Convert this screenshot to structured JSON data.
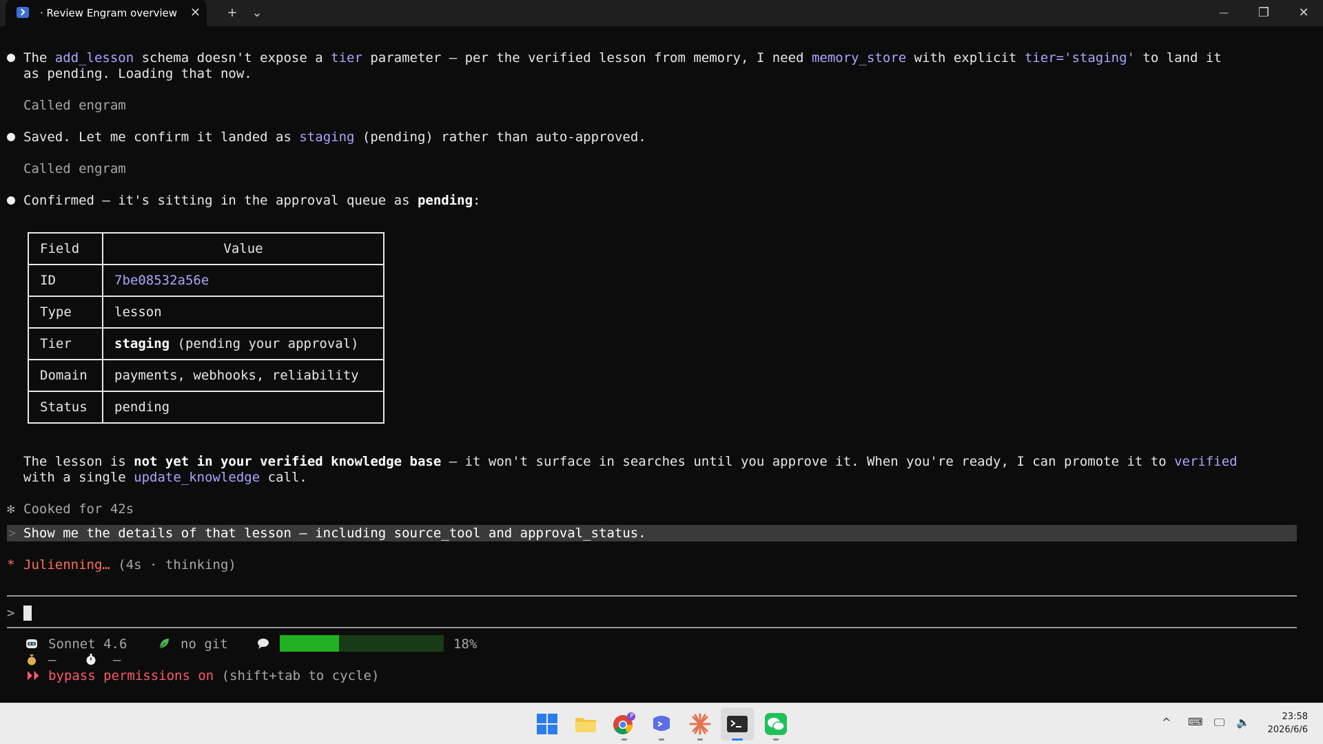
{
  "window": {
    "tab_title": "· Review Engram overview",
    "tab_close": "✕",
    "new_tab": "+",
    "tab_dropdown": "⌄",
    "minimize": "—",
    "maximize": "❐",
    "close": "✕"
  },
  "messages": {
    "m1": {
      "t1": "The ",
      "c1": "add_lesson",
      "t2": " schema doesn't expose a ",
      "c2": "tier",
      "t3": " parameter — per the verified lesson from memory, I need ",
      "c3": "memory_store",
      "t4": " with explicit ",
      "c4": "tier='staging'",
      "t5": " to land it",
      "l2": "as pending. Loading that now."
    },
    "called1": "Called engram",
    "m2": {
      "t1": "Saved. Let me confirm it landed as ",
      "c1": "staging",
      "t2": " (pending) rather than auto-approved."
    },
    "called2": "Called engram",
    "m3": {
      "t1": "Confirmed — it's sitting in the approval queue as ",
      "b1": "pending",
      "t2": ":"
    },
    "table": {
      "headers": [
        "Field",
        "Value"
      ],
      "rows": [
        {
          "field": "ID",
          "value": "7be08532a56e"
        },
        {
          "field": "Type",
          "value": "lesson"
        },
        {
          "field": "Tier",
          "value_bold": "staging",
          "value_rest": " (pending your approval)"
        },
        {
          "field": "Domain",
          "value": "payments, webhooks, reliability"
        },
        {
          "field": "Status",
          "value": "pending"
        }
      ]
    },
    "m4": {
      "t1": "The lesson is ",
      "b1": "not yet in your verified knowledge base",
      "t2": " — it won't surface in searches until you approve it. When you're ready, I can promote it to ",
      "c1": "verified",
      "l2a": "with a single ",
      "c2": "update_knowledge",
      "l2b": " call."
    },
    "cooked_icon": "✻",
    "cooked": "Cooked for 42s"
  },
  "user_prompt": {
    "arrow": ">",
    "text": "Show me the details of that lesson — including source_tool and approval_status."
  },
  "spinner": {
    "icon": "*",
    "label": "Julienning…",
    "detail": " (4s · thinking)"
  },
  "input": {
    "prompt": ">"
  },
  "status": {
    "model": "Sonnet 4.6",
    "git": "no git",
    "context_percent": 18,
    "context_label": "18%",
    "cost": "—",
    "time": "—",
    "mode_arrows": "⏵⏵",
    "mode": "bypass permissions on",
    "mode_hint": " (shift+tab to cycle)"
  },
  "taskbar": {
    "time": "23:58",
    "date": "2026/6/6",
    "chrome_badge": "P"
  },
  "colors": {
    "code": "#a9a6ff",
    "spinner": "#ff6e5a",
    "mode": "#ff5a6e",
    "bar_fill": "#21b021",
    "bar_track": "#173a17"
  }
}
